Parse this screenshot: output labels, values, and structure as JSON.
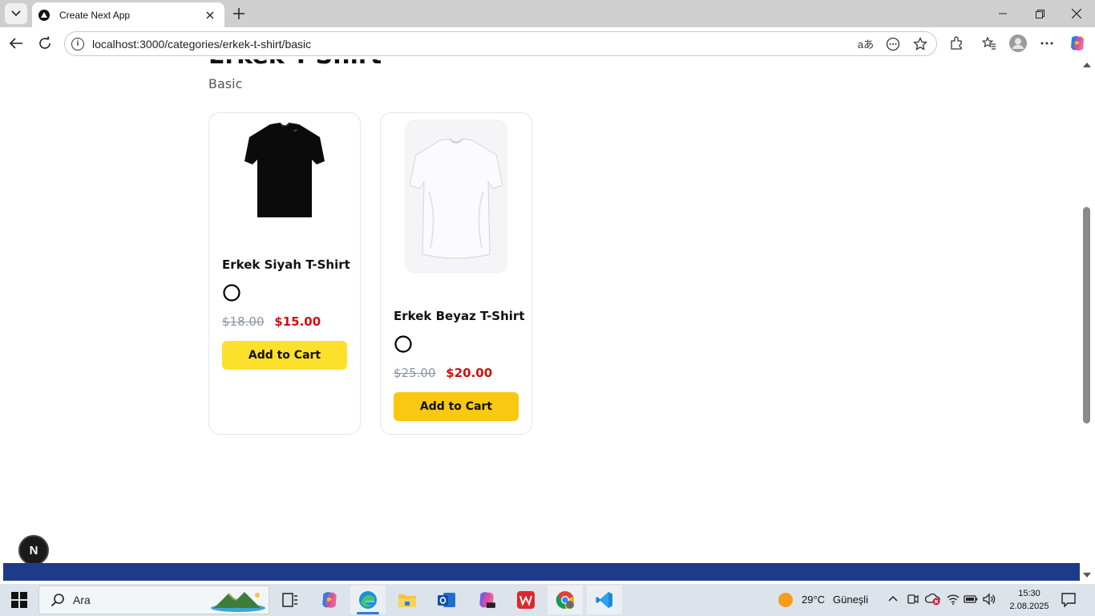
{
  "browser": {
    "tab_title": "Create Next App",
    "url": "localhost:3000/categories/erkek-t-shirt/basic",
    "omnibox_read_aloud": "aあ"
  },
  "page": {
    "title": "Erkek T-Shirt",
    "subtitle": "Basic",
    "products": [
      {
        "name": "Erkek Siyah T-Shirt",
        "old_price": "$18.00",
        "price": "$15.00",
        "button": "Add to Cart",
        "image": "black-tshirt",
        "button_color": "#fde02b"
      },
      {
        "name": "Erkek Beyaz T-Shirt",
        "old_price": "$25.00",
        "price": "$20.00",
        "button": "Add to Cart",
        "image": "white-tshirt",
        "button_color": "#fac711"
      }
    ],
    "next_badge": "N",
    "footer_color": "#1e3a8a"
  },
  "taskbar": {
    "search_placeholder": "Ara",
    "weather_temp": "29°C",
    "weather_text": "Güneşli",
    "time": "15:30",
    "date": "2.08.2025"
  }
}
